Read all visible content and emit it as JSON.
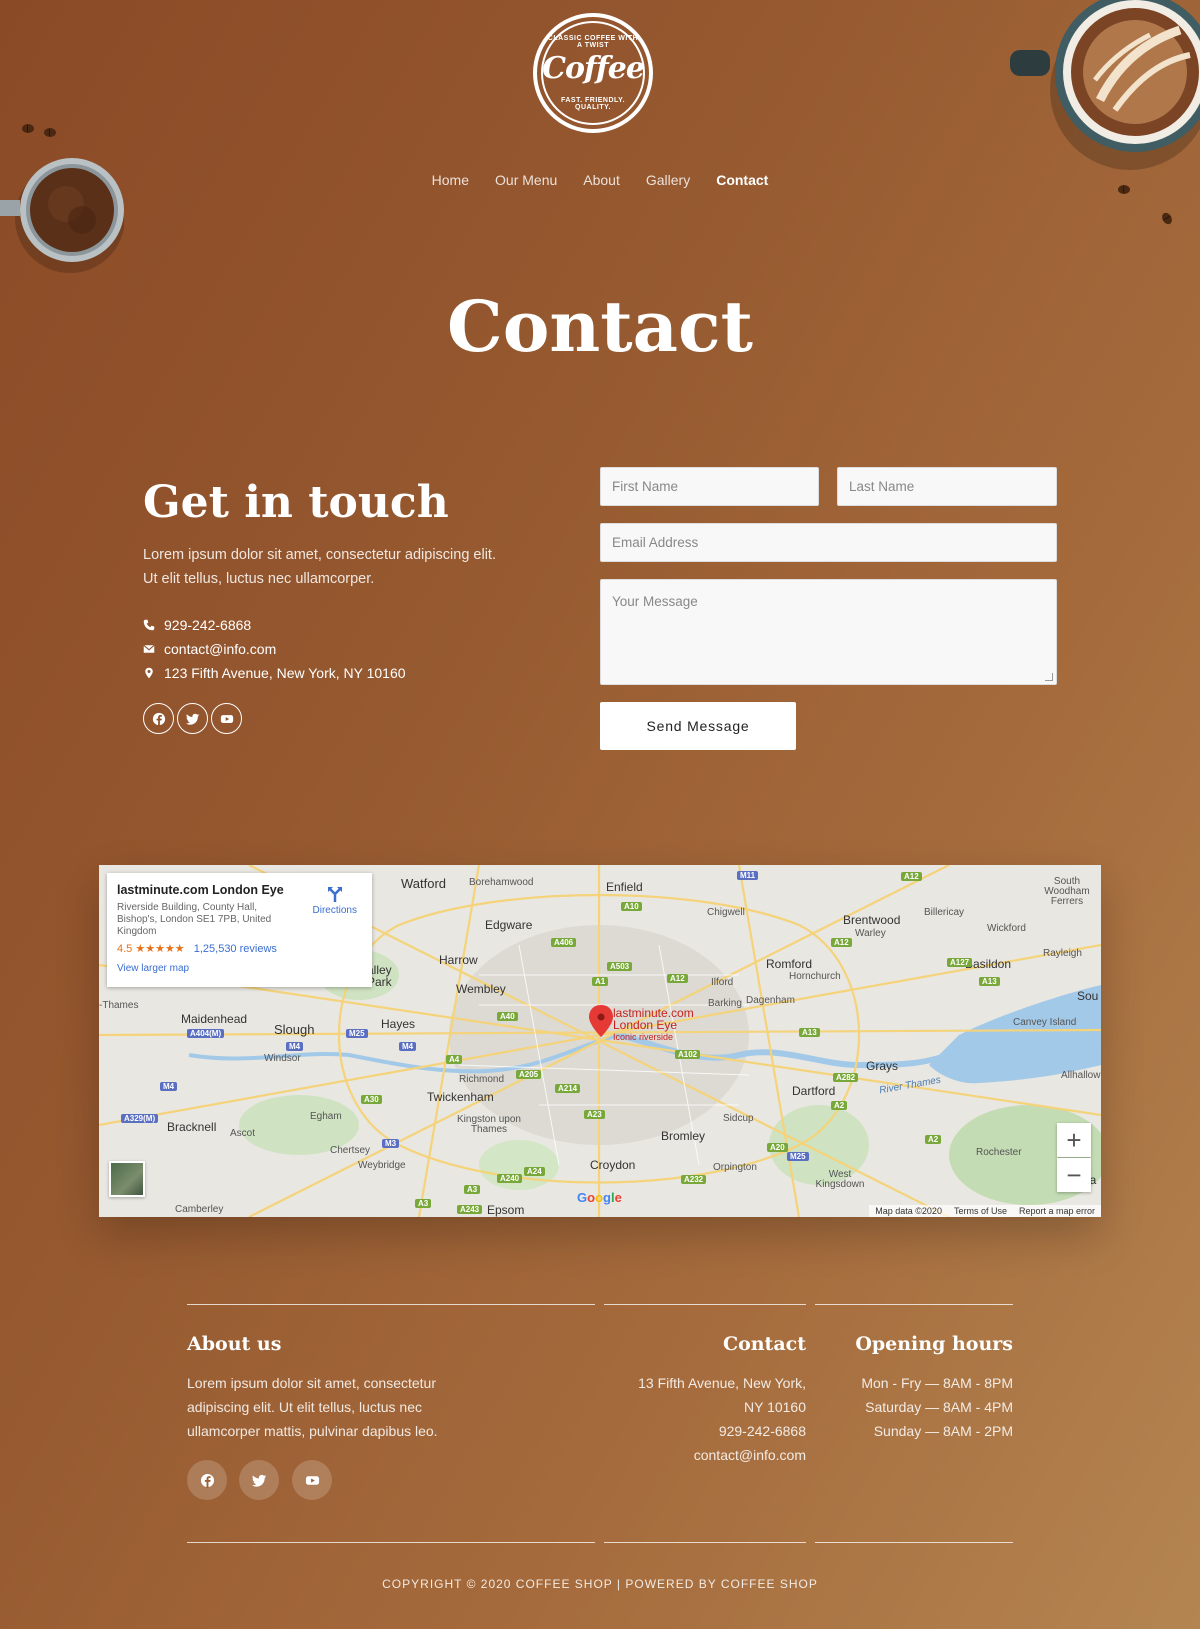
{
  "brand": {
    "logo_word": "Coffee",
    "logo_top_text": "CLASSIC COFFEE WITH A TWIST",
    "logo_bottom_text": "FAST. FRIENDLY. QUALITY."
  },
  "nav": {
    "items": [
      {
        "label": "Home"
      },
      {
        "label": "Our Menu"
      },
      {
        "label": "About"
      },
      {
        "label": "Gallery"
      },
      {
        "label": "Contact",
        "active": true
      }
    ]
  },
  "page_title": "Contact",
  "contact": {
    "heading": "Get in touch",
    "description": "Lorem ipsum dolor sit amet, consectetur adipiscing elit. Ut elit tellus, luctus nec ullamcorper.",
    "phone": "929-242-6868",
    "email": "contact@info.com",
    "address": "123 Fifth Avenue, New York, NY 10160",
    "icons": [
      "phone-icon",
      "envelope-icon",
      "map-marker-icon"
    ],
    "socials": [
      "facebook-icon",
      "twitter-icon",
      "youtube-icon"
    ]
  },
  "form": {
    "first_name_placeholder": "First Name",
    "last_name_placeholder": "Last Name",
    "email_placeholder": "Email Address",
    "message_placeholder": "Your Message",
    "submit_label": "Send Message"
  },
  "map": {
    "card_title": "lastminute.com London Eye",
    "card_address": "Riverside Building, County Hall, Bishop's, London SE1 7PB, United Kingdom",
    "rating": "4.5",
    "stars": "★★★★★",
    "reviews": "1,25,530 reviews",
    "larger_map": "View larger map",
    "directions": "Directions",
    "pin_line1": "lastminute.com",
    "pin_line2": "London Eye",
    "pin_line3": "Iconic riverside",
    "zoom_in": "+",
    "zoom_out": "−",
    "google": "Google",
    "map_data": "Map data ©2020",
    "terms": "Terms of Use",
    "report": "Report a map error",
    "places": [
      "Watford",
      "Borehamwood",
      "Enfield",
      "Chigwell",
      "Brentwood",
      "Warley",
      "Billericay",
      "Wickford",
      "Rayleigh",
      "South Woodham Ferrers",
      "Edgware",
      "Harrow",
      "Wembley",
      "Ilford",
      "Romford",
      "Hornchurch",
      "Basildon",
      "Barking",
      "Dagenham",
      "Sou",
      "Maidenhead",
      "Slough",
      "Windsor",
      "Hayes",
      "Canvey Island",
      "Grays",
      "Allhallow",
      "Richmond",
      "Twickenham",
      "Dartford",
      "Bracknell",
      "Egham",
      "Ascot",
      "Kingston upon Thames",
      "Sidcup",
      "Bromley",
      "Chertsey",
      "Weybridge",
      "Croydon",
      "Orpington",
      "Rochester",
      "West Kingsdown",
      "Camberley",
      "Epsom",
      "alley Park",
      "-Thames",
      "River Thames",
      "Ra"
    ]
  },
  "footer": {
    "about_heading": "About us",
    "about_text": "Lorem ipsum dolor sit amet, consectetur adipiscing elit. Ut elit tellus, luctus nec ullamcorper mattis, pulvinar dapibus leo.",
    "contact_heading": "Contact",
    "contact_address_1": "13 Fifth Avenue, New York,",
    "contact_address_2": "NY 10160",
    "contact_phone": "929-242-6868",
    "contact_email": "contact@info.com",
    "hours_heading": "Opening hours",
    "hours": [
      "Mon - Fry — 8AM - 8PM",
      "Saturday — 8AM - 4PM",
      "Sunday — 8AM - 2PM"
    ],
    "copyright": "COPYRIGHT © 2020 COFFEE SHOP | POWERED BY COFFEE SHOP"
  }
}
